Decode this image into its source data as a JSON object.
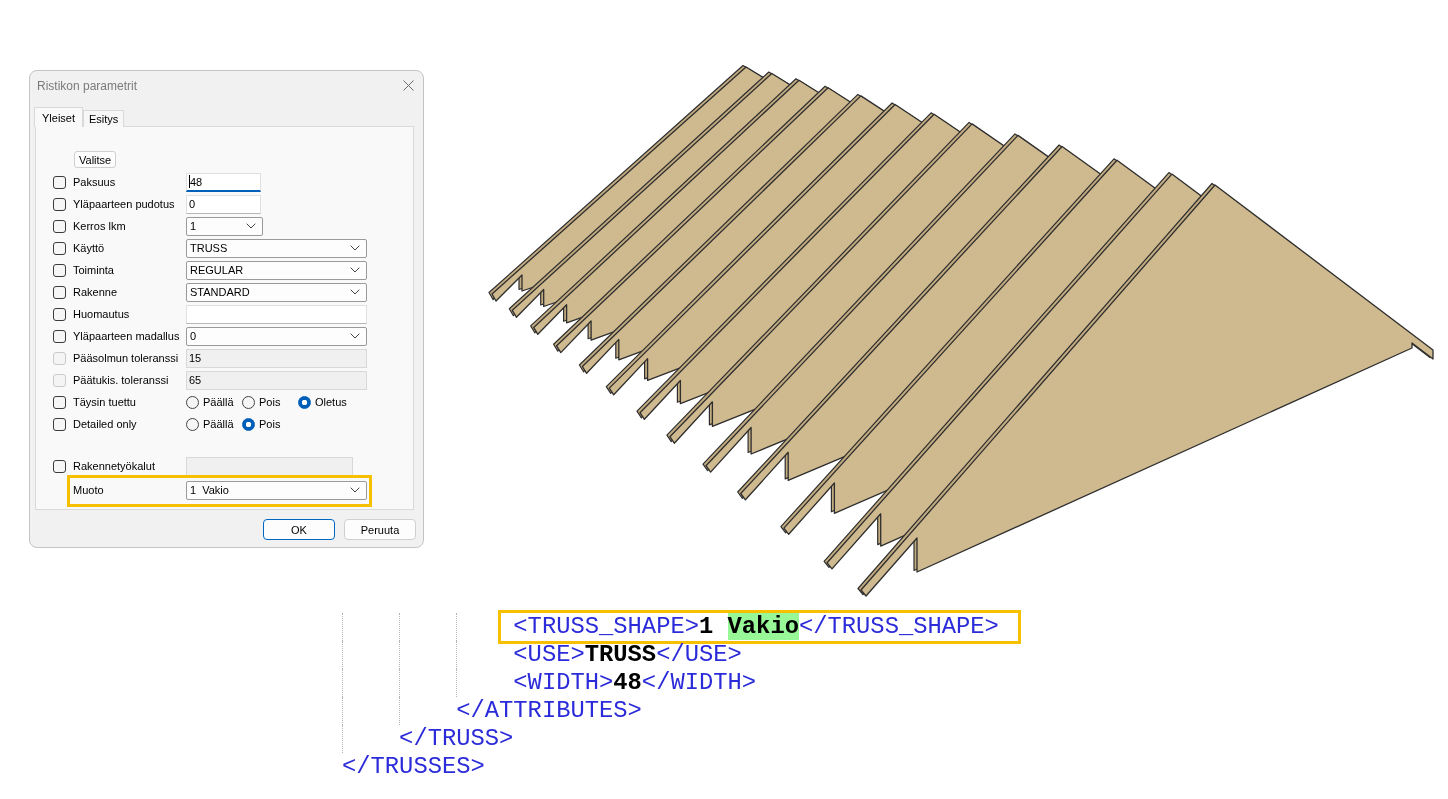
{
  "dialog": {
    "title": "Ristikon parametrit",
    "tabs": [
      {
        "label": "Yleiset",
        "selected": true
      },
      {
        "label": "Esitys",
        "selected": false
      }
    ],
    "select_button": "Valitse",
    "parameters": [
      {
        "label": "Paksuus",
        "checkbox": {
          "checked": false,
          "disabled": false
        },
        "field": {
          "kind": "text",
          "value": "48",
          "focused": true,
          "disabled": false
        }
      },
      {
        "label": "Yläpaarteen pudotus",
        "checkbox": {
          "checked": false,
          "disabled": false
        },
        "field": {
          "kind": "text",
          "value": "0",
          "focused": false,
          "disabled": false
        }
      },
      {
        "label": "Kerros lkm",
        "checkbox": {
          "checked": false,
          "disabled": false
        },
        "field": {
          "kind": "dropdown",
          "value": "1"
        }
      },
      {
        "label": "Käyttö",
        "checkbox": {
          "checked": false,
          "disabled": false
        },
        "field": {
          "kind": "dropdown",
          "value": "TRUSS"
        }
      },
      {
        "label": "Toiminta",
        "checkbox": {
          "checked": false,
          "disabled": false
        },
        "field": {
          "kind": "dropdown",
          "value": "REGULAR"
        }
      },
      {
        "label": "Rakenne",
        "checkbox": {
          "checked": false,
          "disabled": false
        },
        "field": {
          "kind": "dropdown",
          "value": "STANDARD"
        }
      },
      {
        "label": "Huomautus",
        "checkbox": {
          "checked": false,
          "disabled": false
        },
        "field": {
          "kind": "text",
          "focused": false,
          "disabled": false
        }
      },
      {
        "label": "Yläpaarteen madallus",
        "checkbox": {
          "checked": false,
          "disabled": false
        },
        "field": {
          "kind": "dropdown",
          "value": "0"
        }
      },
      {
        "label": "Pääsolmun toleranssi",
        "checkbox": {
          "checked": false,
          "disabled": true
        },
        "field": {
          "kind": "text",
          "value": "15",
          "focused": false,
          "disabled": true
        }
      },
      {
        "label": "Päätukis. toleranssi",
        "checkbox": {
          "checked": false,
          "disabled": true
        },
        "field": {
          "kind": "text",
          "value": "65",
          "focused": false,
          "disabled": true
        }
      },
      {
        "label": "Täysin tuettu",
        "checkbox": {
          "checked": false,
          "disabled": false
        },
        "field": {
          "kind": "radio",
          "options": [
            {
              "label": "Päällä",
              "selected": false
            },
            {
              "label": "Pois",
              "selected": false
            },
            {
              "label": "Oletus",
              "selected": true
            }
          ]
        }
      },
      {
        "label": "Detailed only",
        "checkbox": {
          "checked": false,
          "disabled": false
        },
        "field": {
          "kind": "radio",
          "options": [
            {
              "label": "Päällä",
              "selected": false
            },
            {
              "label": "Pois",
              "selected": true
            }
          ]
        }
      }
    ],
    "tools": [
      {
        "label": "Rakennetyökalut",
        "checkbox": {
          "checked": false,
          "disabled": false
        },
        "field": {
          "kind": "text",
          "focused": false,
          "disabled": true
        },
        "boxed": false
      },
      {
        "label": "Muoto",
        "field": {
          "kind": "dropdown",
          "value": "1  Vakio"
        },
        "boxed": true
      }
    ],
    "buttons": [
      {
        "label": "OK",
        "default": true
      },
      {
        "label": "Peruuta",
        "default": false
      }
    ]
  },
  "xml_view": {
    "close_tag": "</TRUSSES>",
    "children": [
      {
        "close_tag": "</TRUSS>",
        "children": [
          {
            "close_tag": "</ATTRIBUTES>",
            "children": [
              {
                "open_tag": "<TRUSS_SHAPE>",
                "value": [
                  {
                    "text": "1 ",
                    "kind": "plain"
                  },
                  {
                    "text": "Vakio",
                    "kind": "match"
                  }
                ],
                "close_tag": "</TRUSS_SHAPE>",
                "boxed": true
              },
              {
                "open_tag": "<USE>",
                "value": [
                  {
                    "text": "TRUSS",
                    "kind": "plain"
                  }
                ],
                "close_tag": "</USE>",
                "boxed": false
              },
              {
                "open_tag": "<WIDTH>",
                "value": [
                  {
                    "text": "48",
                    "kind": "plain"
                  }
                ],
                "close_tag": "</WIDTH>",
                "boxed": false
              }
            ]
          }
        ]
      }
    ]
  }
}
